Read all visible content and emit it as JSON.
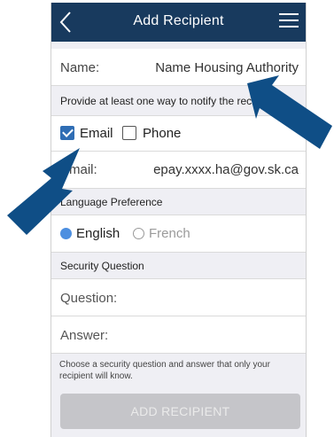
{
  "header": {
    "title": "Add Recipient"
  },
  "form": {
    "name_label": "Name:",
    "name_value": "Name Housing Authority",
    "notify_header": "Provide at least one way to notify the recipient",
    "email_option": "Email",
    "email_checked": true,
    "phone_option": "Phone",
    "phone_checked": false,
    "email_label": "Email:",
    "email_value": "epay.xxxx.ha@gov.sk.ca",
    "language_header": "Language Preference",
    "language_options": [
      "English",
      "French"
    ],
    "language_selected": "English",
    "security_header": "Security Question",
    "question_placeholder": "Question:",
    "answer_placeholder": "Answer:",
    "help_text": "Choose a security question and answer that only your recipient will know.",
    "submit_label": "ADD RECIPIENT"
  },
  "colors": {
    "navbar": "#183a5e",
    "arrow": "#0f4e86",
    "checkbox": "#2f6db4",
    "radio_selected": "#4d8fe0",
    "button_disabled": "#c5c5c9"
  }
}
